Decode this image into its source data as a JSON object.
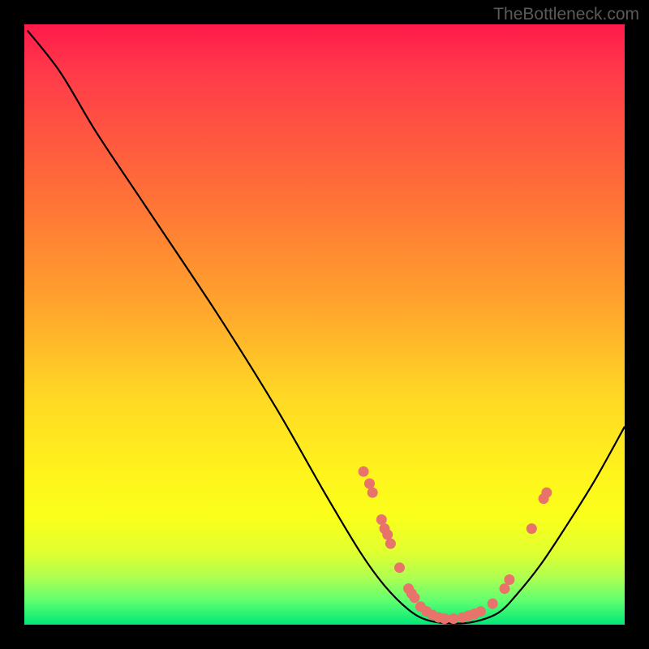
{
  "watermark": "TheBottleneck.com",
  "chart_data": {
    "type": "line",
    "title": "",
    "xlabel": "",
    "ylabel": "",
    "xlim": [
      0,
      100
    ],
    "ylim": [
      0,
      100
    ],
    "curve": [
      {
        "x": 0.5,
        "y": 99
      },
      {
        "x": 6,
        "y": 92
      },
      {
        "x": 12,
        "y": 82
      },
      {
        "x": 20,
        "y": 70
      },
      {
        "x": 32,
        "y": 52
      },
      {
        "x": 42,
        "y": 36
      },
      {
        "x": 50,
        "y": 22
      },
      {
        "x": 56,
        "y": 12
      },
      {
        "x": 60,
        "y": 6.5
      },
      {
        "x": 64,
        "y": 2.5
      },
      {
        "x": 67,
        "y": 0.8
      },
      {
        "x": 71,
        "y": 0.2
      },
      {
        "x": 75,
        "y": 0.5
      },
      {
        "x": 79,
        "y": 2
      },
      {
        "x": 82,
        "y": 5
      },
      {
        "x": 86,
        "y": 10
      },
      {
        "x": 90,
        "y": 16
      },
      {
        "x": 95,
        "y": 24
      },
      {
        "x": 100,
        "y": 33
      }
    ],
    "points": [
      {
        "x": 56.5,
        "y": 25.5
      },
      {
        "x": 57.5,
        "y": 23.5
      },
      {
        "x": 58,
        "y": 22
      },
      {
        "x": 59.5,
        "y": 17.5
      },
      {
        "x": 60,
        "y": 16
      },
      {
        "x": 60.5,
        "y": 15
      },
      {
        "x": 61,
        "y": 13.5
      },
      {
        "x": 62.5,
        "y": 9.5
      },
      {
        "x": 64,
        "y": 6
      },
      {
        "x": 64.5,
        "y": 5.2
      },
      {
        "x": 65,
        "y": 4.5
      },
      {
        "x": 66,
        "y": 3
      },
      {
        "x": 67,
        "y": 2.2
      },
      {
        "x": 68,
        "y": 1.6
      },
      {
        "x": 69,
        "y": 1.2
      },
      {
        "x": 70,
        "y": 1
      },
      {
        "x": 71.5,
        "y": 1
      },
      {
        "x": 73,
        "y": 1.2
      },
      {
        "x": 74,
        "y": 1.5
      },
      {
        "x": 75,
        "y": 1.8
      },
      {
        "x": 76,
        "y": 2.2
      },
      {
        "x": 78,
        "y": 3.5
      },
      {
        "x": 80,
        "y": 6
      },
      {
        "x": 80.8,
        "y": 7.5
      },
      {
        "x": 84.5,
        "y": 16
      },
      {
        "x": 86.5,
        "y": 21
      },
      {
        "x": 87,
        "y": 22
      }
    ],
    "point_color": "#e8736b",
    "curve_color": "#000000",
    "background_gradient": [
      "#ff1a4a",
      "#ff5a3f",
      "#ffa82c",
      "#ffd824",
      "#fff41c",
      "#b0ff50",
      "#00e878"
    ]
  }
}
